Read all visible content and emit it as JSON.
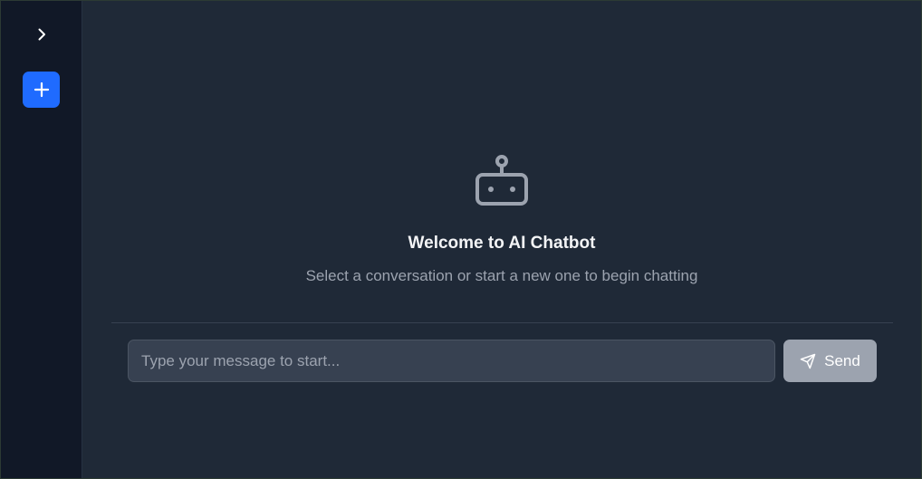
{
  "sidebar": {
    "toggle_icon": "chevron-right-icon",
    "new_chat_icon": "plus-icon",
    "new_chat_color": "#1f6bff"
  },
  "welcome": {
    "icon": "robot-icon",
    "title": "Welcome to AI Chatbot",
    "subtitle": "Select a conversation or start a new one to begin chatting"
  },
  "composer": {
    "placeholder": "Type your message to start...",
    "value": "",
    "send_label": "Send",
    "send_icon": "send-icon"
  },
  "colors": {
    "sidebar_bg": "#111827",
    "main_bg": "#1f2937",
    "input_bg": "#374151",
    "send_bg": "#9ca3af"
  }
}
